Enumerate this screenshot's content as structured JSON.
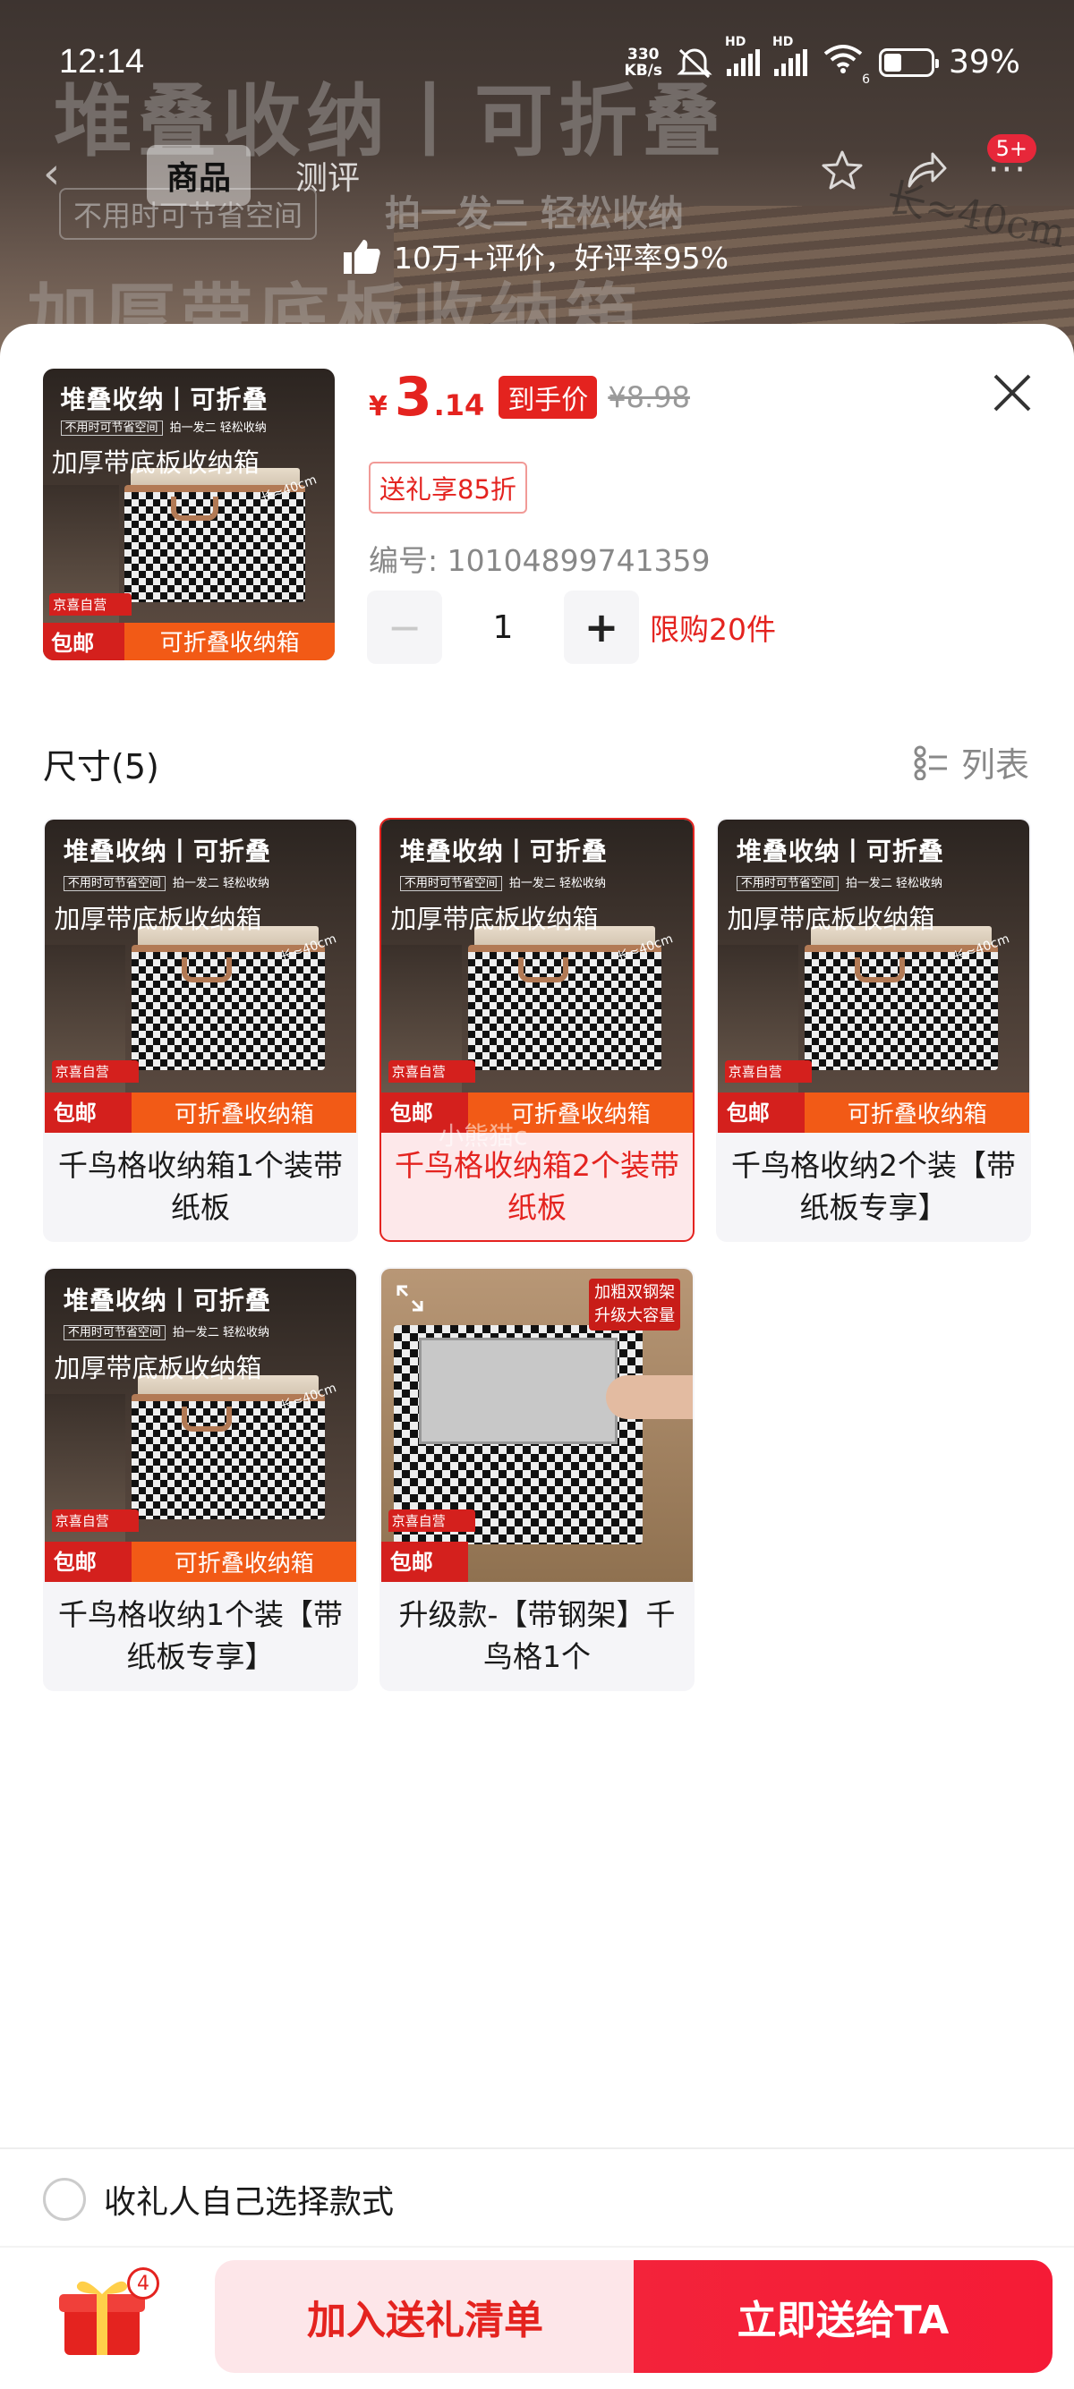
{
  "status_bar": {
    "time": "12:14",
    "net_speed": "330",
    "net_unit": "KB/s",
    "hd1": "HD",
    "hd2": "HD",
    "wifi_gen": "6",
    "battery_text": "39%",
    "battery_level": 0.39
  },
  "background": {
    "banner_big": "堆叠收纳丨可折叠",
    "banner_big2": "加厚带底板收纳箱",
    "banner_sub1": "不用时可节省空间",
    "banner_sub2": "拍一发二 轻松收纳",
    "banner_size": "长≈40cm",
    "tabs": [
      {
        "label": "商品"
      },
      {
        "label": "测评"
      }
    ],
    "cart_badge": "5+",
    "rating_text": "10万+评价，好评率95%"
  },
  "product": {
    "price_currency": "¥",
    "price_int": "3",
    "price_dec": ".14",
    "price_tag": "到手价",
    "price_original": "¥8.98",
    "gift_discount": "送礼享85折",
    "sku": "编号: 10104899741359",
    "quantity": "1",
    "limit": "限购20件"
  },
  "image_text": {
    "title": "堆叠收纳丨可折叠",
    "sub_a": "不用时可节省空间",
    "sub_b": "拍一发二 轻松收纳",
    "subtitle": "加厚带底板收纳箱",
    "size": "长≈40cm",
    "jd_label": "京喜自营",
    "free_ship": "包邮",
    "band_text": "可折叠收纳箱",
    "tag_line1": "加粗双钢架",
    "tag_line2": "升级大容量"
  },
  "size_section": {
    "title": "尺寸(5)",
    "toggle_label": "列表",
    "options": [
      {
        "label": "千鸟格收纳箱1个装带纸板",
        "selected": false
      },
      {
        "label": "千鸟格收纳箱2个装带纸板",
        "selected": true
      },
      {
        "label": "千鸟格收纳2个装【带纸板专享】",
        "selected": false
      },
      {
        "label": "千鸟格收纳1个装【带纸板专享】",
        "selected": false
      },
      {
        "label": "升级款-【带钢架】千鸟格1个",
        "selected": false
      }
    ],
    "watermark": "小熊猫c"
  },
  "footer": {
    "choose_label": "收礼人自己选择款式",
    "gift_count": "4",
    "add_list_label": "加入送礼清单",
    "send_label": "立即送给TA"
  },
  "colors": {
    "accent": "#e4231f",
    "selected_bg": "#fde8ea",
    "send_button": "#f3233a"
  }
}
